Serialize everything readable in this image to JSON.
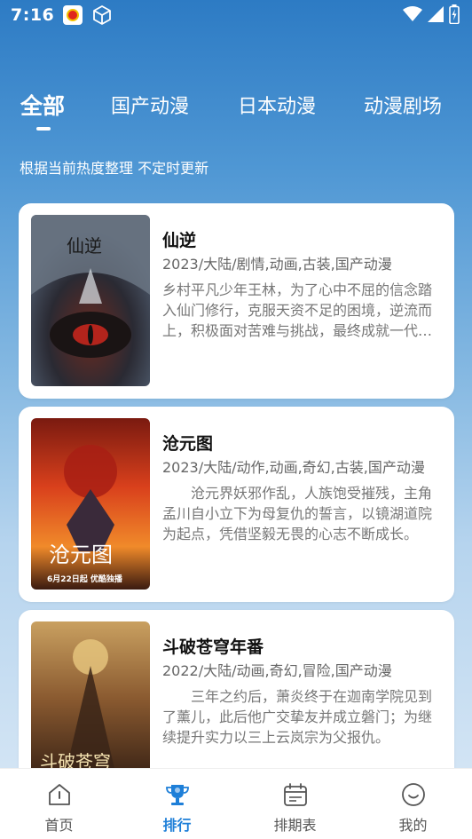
{
  "status_bar": {
    "time": "7:16"
  },
  "tabs": [
    {
      "label": "全部",
      "active": true
    },
    {
      "label": "国产动漫",
      "active": false
    },
    {
      "label": "日本动漫",
      "active": false
    },
    {
      "label": "动漫剧场",
      "active": false
    }
  ],
  "subtitle": "根据当前热度整理 不定时更新",
  "items": [
    {
      "title": "仙逆",
      "meta": "2023/大陆/剧情,动画,古装,国产动漫",
      "desc": "乡村平凡少年王林，为了心中不屈的信念踏入仙门修行，克服天资不足的困境，逆流而上，积极面对苦难与挑战，最终成就一代仙尊。",
      "poster_text": "仙逆"
    },
    {
      "title": "沧元图",
      "meta": "2023/大陆/动作,动画,奇幻,古装,国产动漫",
      "desc": "　　沧元界妖邪作乱，人族饱受摧残，主角孟川自小立下为母复仇的誓言，以镜湖道院为起点，凭借坚毅无畏的心志不断成长。",
      "poster_text": "沧元图",
      "poster_caption": "6月22日起 优酷独播"
    },
    {
      "title": "斗破苍穹年番",
      "meta": "2022/大陆/动画,奇幻,冒险,国产动漫",
      "desc": "　　三年之约后，萧炎终于在迦南学院见到了薰儿，此后他广交挚友并成立磐门；为继续提升实力以三上云岚宗为父报仇。",
      "poster_text": "斗破苍穹"
    }
  ],
  "bottom_nav": [
    {
      "label": "首页",
      "icon": "home-icon"
    },
    {
      "label": "排行",
      "icon": "trophy-icon",
      "active": true
    },
    {
      "label": "排期表",
      "icon": "calendar-icon"
    },
    {
      "label": "我的",
      "icon": "smile-icon"
    }
  ],
  "colors": {
    "accent": "#1e7fd8"
  }
}
